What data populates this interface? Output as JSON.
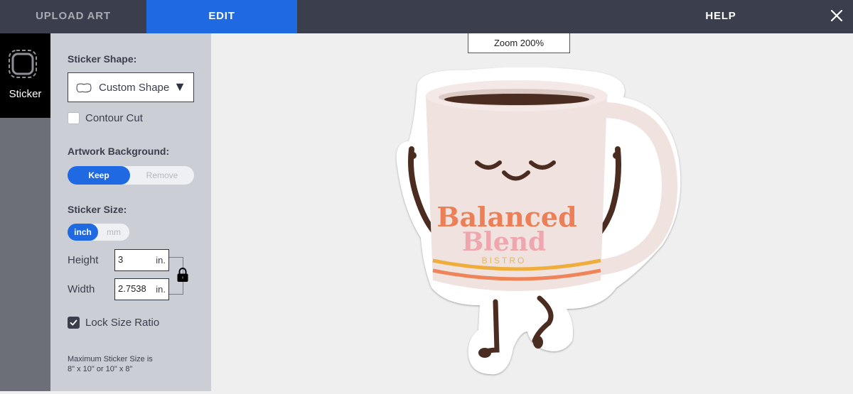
{
  "header": {
    "tabs": [
      {
        "label": "UPLOAD ART",
        "active": false
      },
      {
        "label": "EDIT",
        "active": true
      },
      {
        "label": "HELP",
        "active": false
      }
    ],
    "close_icon": "close-icon",
    "accent_color": "#1f6ae2"
  },
  "rail": {
    "items": [
      {
        "label": "Sticker",
        "icon": "sticker-shape-icon",
        "active": true
      }
    ]
  },
  "panel": {
    "shape_label": "Sticker Shape:",
    "shape_value": "Custom Shape",
    "shape_icon": "custom-shape-icon",
    "contour_cut": {
      "label": "Contour Cut",
      "checked": false
    },
    "background_label": "Artwork Background:",
    "background_options": [
      {
        "label": "Keep",
        "selected": true
      },
      {
        "label": "Remove",
        "selected": false
      }
    ],
    "size_label": "Sticker Size:",
    "unit_options": [
      {
        "label": "inch",
        "selected": true
      },
      {
        "label": "mm",
        "selected": false
      }
    ],
    "height": {
      "label": "Height",
      "value": "3",
      "unit": "in."
    },
    "width": {
      "label": "Width",
      "value": "2.7538",
      "unit": "in."
    },
    "lock_icon": "lock-icon",
    "lock_ratio": {
      "label": "Lock Size Ratio",
      "checked": true
    },
    "max_note_line1": "Maximum Sticker Size is",
    "max_note_line2": "8\" x 10\" or 10\" x 8\""
  },
  "canvas": {
    "zoom_label": "Zoom 200%",
    "artwork": {
      "title": "Balanced",
      "subtitle": "Blend",
      "tagline": "BISTRO",
      "colors": {
        "title": "#ec7f55",
        "subtitle": "#f0a6ae",
        "tagline": "#e6b85a",
        "mug": "#efe2df",
        "coffee": "#4a2c20",
        "stripe1": "#efae3c",
        "stripe2": "#ee8458"
      }
    }
  }
}
